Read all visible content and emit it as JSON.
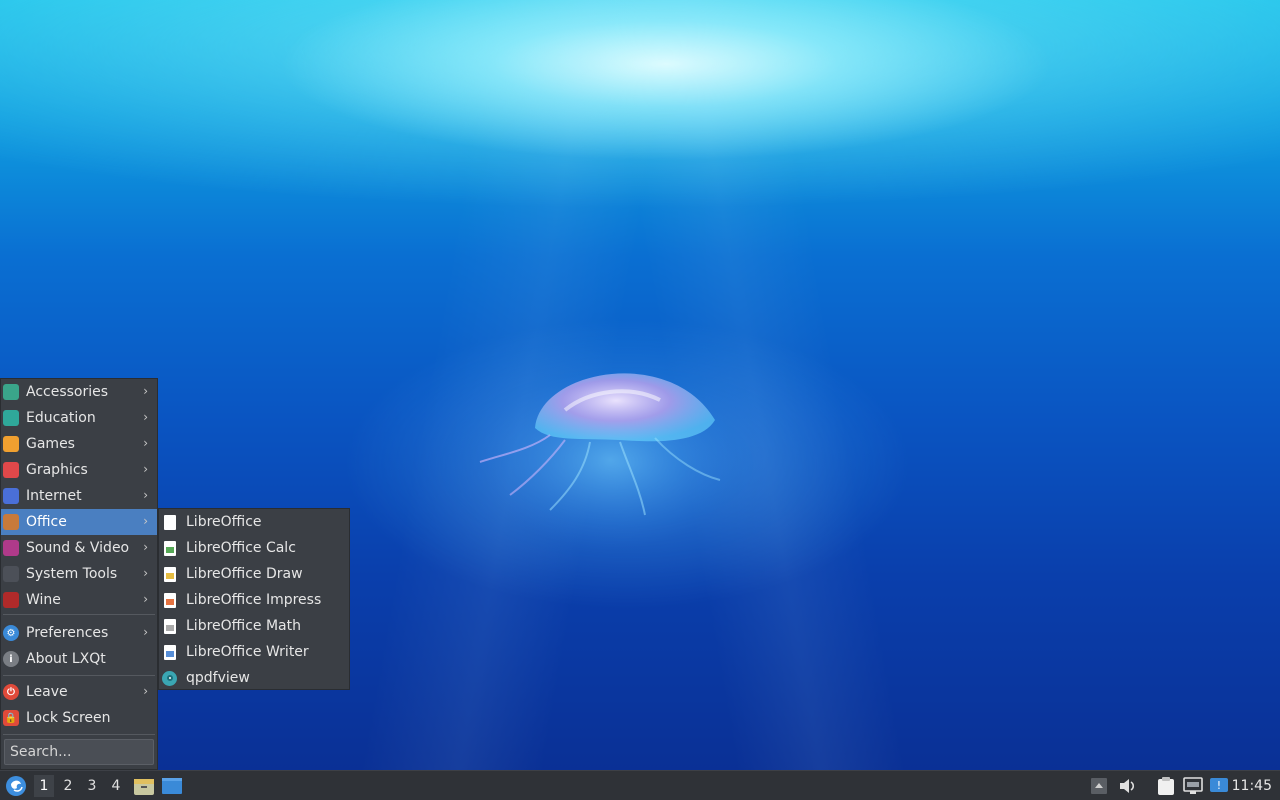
{
  "menu": {
    "items": [
      {
        "label": "Accessories",
        "icon": "accessories-icon",
        "color": "#3aa58a"
      },
      {
        "label": "Education",
        "icon": "education-icon",
        "color": "#2fa89a"
      },
      {
        "label": "Games",
        "icon": "games-icon",
        "color": "#f0a030"
      },
      {
        "label": "Graphics",
        "icon": "graphics-icon",
        "color": "#e0484a"
      },
      {
        "label": "Internet",
        "icon": "internet-icon",
        "color": "#4a6fd8"
      },
      {
        "label": "Office",
        "icon": "office-icon",
        "color": "#c87a3a"
      },
      {
        "label": "Sound & Video",
        "icon": "sound-video-icon",
        "color": "#b03a8a"
      },
      {
        "label": "System Tools",
        "icon": "system-tools-icon",
        "color": "#4c5058"
      },
      {
        "label": "Wine",
        "icon": "wine-icon",
        "color": "#b02a2a"
      }
    ],
    "preferences": "Preferences",
    "about": "About LXQt",
    "leave": "Leave",
    "lock": "Lock Screen",
    "search_placeholder": "Search...",
    "active_item": "Office",
    "arrow_glyph": "›"
  },
  "submenu": {
    "items": [
      {
        "label": "LibreOffice",
        "color": "#ffffff"
      },
      {
        "label": "LibreOffice Calc",
        "color": "#3a9a3a"
      },
      {
        "label": "LibreOffice Draw",
        "color": "#e0b020"
      },
      {
        "label": "LibreOffice Impress",
        "color": "#e05a20"
      },
      {
        "label": "LibreOffice Math",
        "color": "#9a9a9a"
      },
      {
        "label": "LibreOffice Writer",
        "color": "#3a7ad0"
      },
      {
        "label": "qpdfview",
        "color": "#3aa6b3"
      }
    ]
  },
  "taskbar": {
    "workspaces": [
      "1",
      "2",
      "3",
      "4"
    ],
    "current_workspace": "1",
    "clock": "11:45"
  }
}
